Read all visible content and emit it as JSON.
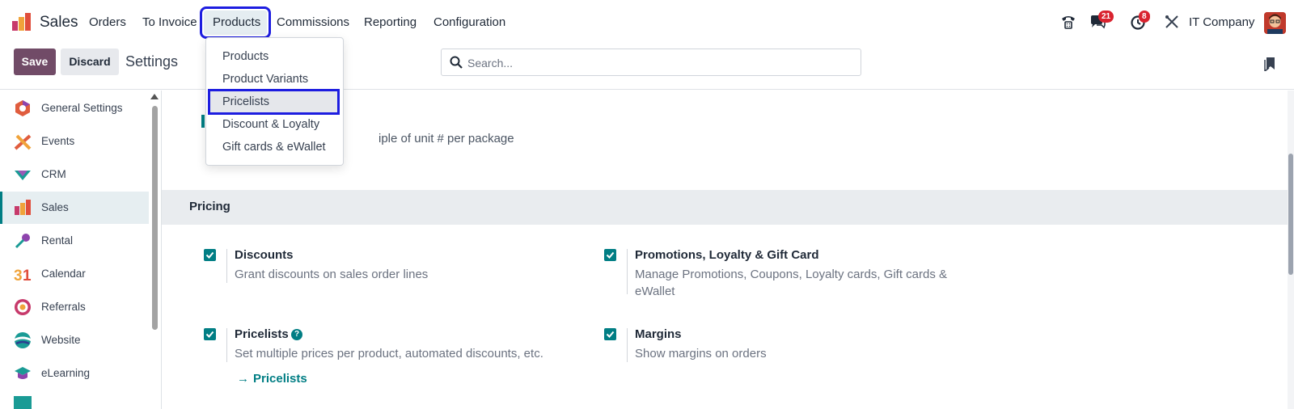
{
  "app": {
    "name": "Sales"
  },
  "menu": {
    "items": [
      "Orders",
      "To Invoice",
      "Products",
      "Commissions",
      "Reporting",
      "Configuration"
    ]
  },
  "systray": {
    "messages_count": "21",
    "activities_count": "8",
    "company": "IT Company"
  },
  "controlbar": {
    "save_label": "Save",
    "discard_label": "Discard",
    "breadcrumb": "Settings",
    "search_placeholder": "Search..."
  },
  "sidebar": {
    "items": [
      {
        "label": "General Settings",
        "icon": "general-settings-icon",
        "active": false
      },
      {
        "label": "Events",
        "icon": "events-icon",
        "active": false
      },
      {
        "label": "CRM",
        "icon": "crm-icon",
        "active": false
      },
      {
        "label": "Sales",
        "icon": "sales-icon",
        "active": true
      },
      {
        "label": "Rental",
        "icon": "rental-icon",
        "active": false
      },
      {
        "label": "Calendar",
        "icon": "calendar-icon",
        "active": false
      },
      {
        "label": "Referrals",
        "icon": "referrals-icon",
        "active": false
      },
      {
        "label": "Website",
        "icon": "website-icon",
        "active": false
      },
      {
        "label": "eLearning",
        "icon": "elearning-icon",
        "active": false
      }
    ]
  },
  "dropdown": {
    "items": [
      "Products",
      "Product Variants",
      "Pricelists",
      "Discount & Loyalty",
      "Gift cards & eWallet"
    ],
    "highlighted": "Pricelists"
  },
  "main": {
    "partial_text": "iple of unit # per package",
    "section_title": "Pricing",
    "settings": [
      {
        "title": "Discounts",
        "desc": "Grant discounts on sales order lines",
        "checked": true
      },
      {
        "title": "Promotions, Loyalty & Gift Card",
        "desc": "Manage Promotions, Coupons, Loyalty cards, Gift cards & eWallet",
        "checked": true
      },
      {
        "title": "Pricelists",
        "desc": "Set multiple prices per product, automated discounts, etc.",
        "checked": true,
        "link": "Pricelists"
      },
      {
        "title": "Margins",
        "desc": "Show margins on orders",
        "checked": true
      }
    ]
  },
  "colors": {
    "brand": "#714b67",
    "accent": "#017e84",
    "highlight_outline": "#1d1de0"
  }
}
